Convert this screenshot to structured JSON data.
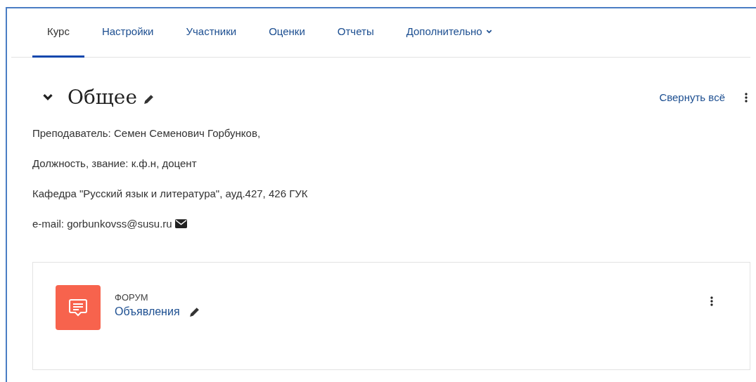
{
  "tabs": [
    {
      "label": "Курс",
      "selected": true
    },
    {
      "label": "Настройки",
      "selected": false
    },
    {
      "label": "Участники",
      "selected": false
    },
    {
      "label": "Оценки",
      "selected": false
    },
    {
      "label": "Отчеты",
      "selected": false
    },
    {
      "label": "Дополнительно",
      "selected": false,
      "dropdown": true
    }
  ],
  "section": {
    "title": "Общее",
    "expanded": true,
    "collapse_all": "Свернуть всё"
  },
  "paragraphs": [
    "Преподаватель: Семен Семенович Горбунков,",
    "Должность, звание: к.ф.н, доцент",
    "Кафедра \"Русский язык и литература\",  ауд.427, 426 ГУК"
  ],
  "email": {
    "label": "e-mail: gorbunkovss@susu.ru"
  },
  "activity": {
    "type": "ФОРУМ",
    "name": "Объявления"
  }
}
